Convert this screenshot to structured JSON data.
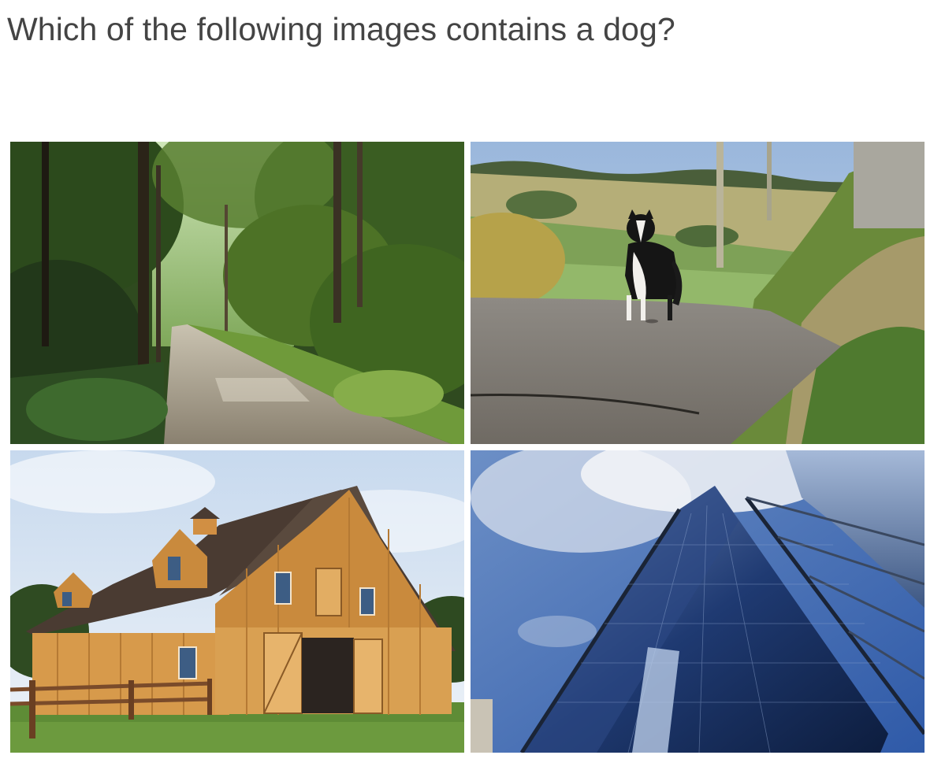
{
  "question": "Which of the following images contains a dog?",
  "images": [
    {
      "label": "forest-path"
    },
    {
      "label": "dog-on-road"
    },
    {
      "label": "wooden-barn"
    },
    {
      "label": "glass-skyscraper"
    }
  ]
}
